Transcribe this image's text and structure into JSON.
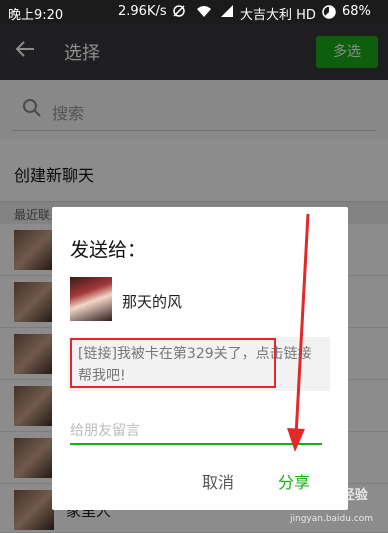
{
  "status_bar": {
    "time": "晚上9:20",
    "speed": "2.96K/s",
    "carrier": "大吉大利 HD",
    "battery": "68%"
  },
  "header": {
    "back_icon": "back-arrow-icon",
    "title": "选择",
    "multi_select": "多选"
  },
  "search": {
    "placeholder": "搜索"
  },
  "new_chat": "创建新聊天",
  "recent_label": "最近联系人",
  "list": [
    {
      "name": ""
    },
    {
      "name": ""
    },
    {
      "name": ""
    },
    {
      "name": ""
    },
    {
      "name": ""
    },
    {
      "name": "家里人"
    }
  ],
  "dialog": {
    "title": "发送给：",
    "recipient": "那天的风",
    "link_text": "[链接]我被卡在第329关了，点击链接帮我吧!",
    "message_placeholder": "给朋友留言",
    "cancel": "取消",
    "share": "分享"
  },
  "watermark": {
    "text": "Baidu经验",
    "url": "jingyan.baidu.com"
  },
  "colors": {
    "accent": "#1aad19",
    "appbar": "#393a3f",
    "annotation": "#e12929"
  }
}
